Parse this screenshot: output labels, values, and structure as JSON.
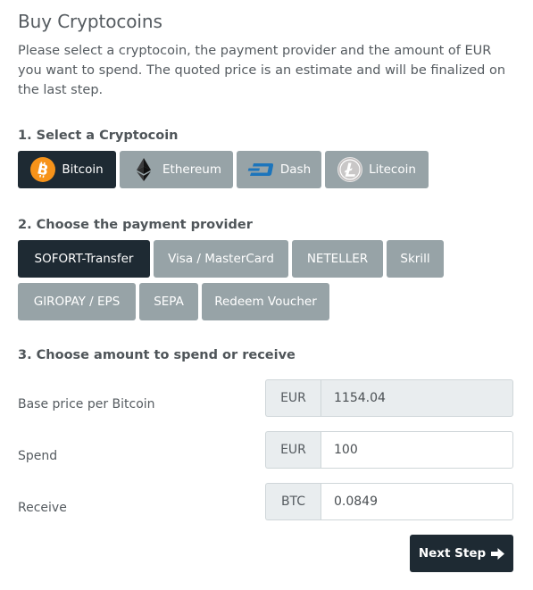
{
  "page": {
    "title": "Buy Cryptocoins",
    "intro": "Please select a cryptocoin, the payment provider and the amount of EUR you want to spend. The quoted price is an estimate and will be finalized on the last step."
  },
  "step1": {
    "title": "1. Select a Cryptocoin",
    "coins": [
      {
        "label": "Bitcoin",
        "icon": "bitcoin-icon",
        "active": true
      },
      {
        "label": "Ethereum",
        "icon": "ethereum-icon",
        "active": false
      },
      {
        "label": "Dash",
        "icon": "dash-icon",
        "active": false
      },
      {
        "label": "Litecoin",
        "icon": "litecoin-icon",
        "active": false
      }
    ]
  },
  "step2": {
    "title": "2. Choose the payment provider",
    "providers": [
      {
        "label": "SOFORT-Transfer",
        "active": true
      },
      {
        "label": "Visa / MasterCard",
        "active": false
      },
      {
        "label": "NETELLER",
        "active": false
      },
      {
        "label": "Skrill",
        "active": false
      },
      {
        "label": "GIROPAY / EPS",
        "active": false
      },
      {
        "label": "SEPA",
        "active": false
      },
      {
        "label": "Redeem Voucher",
        "active": false
      }
    ]
  },
  "step3": {
    "title": "3. Choose amount to spend or receive",
    "base_price": {
      "label": "Base price per Bitcoin",
      "currency": "EUR",
      "value": "1154.04"
    },
    "spend": {
      "label": "Spend",
      "currency": "EUR",
      "value": "100"
    },
    "receive": {
      "label": "Receive",
      "currency": "BTC",
      "value": "0.0849"
    }
  },
  "actions": {
    "next_label": "Next Step"
  },
  "colors": {
    "active_button": "#1e2a33",
    "inactive_button": "#97a3a7",
    "bitcoin_orange": "#f7931a"
  }
}
